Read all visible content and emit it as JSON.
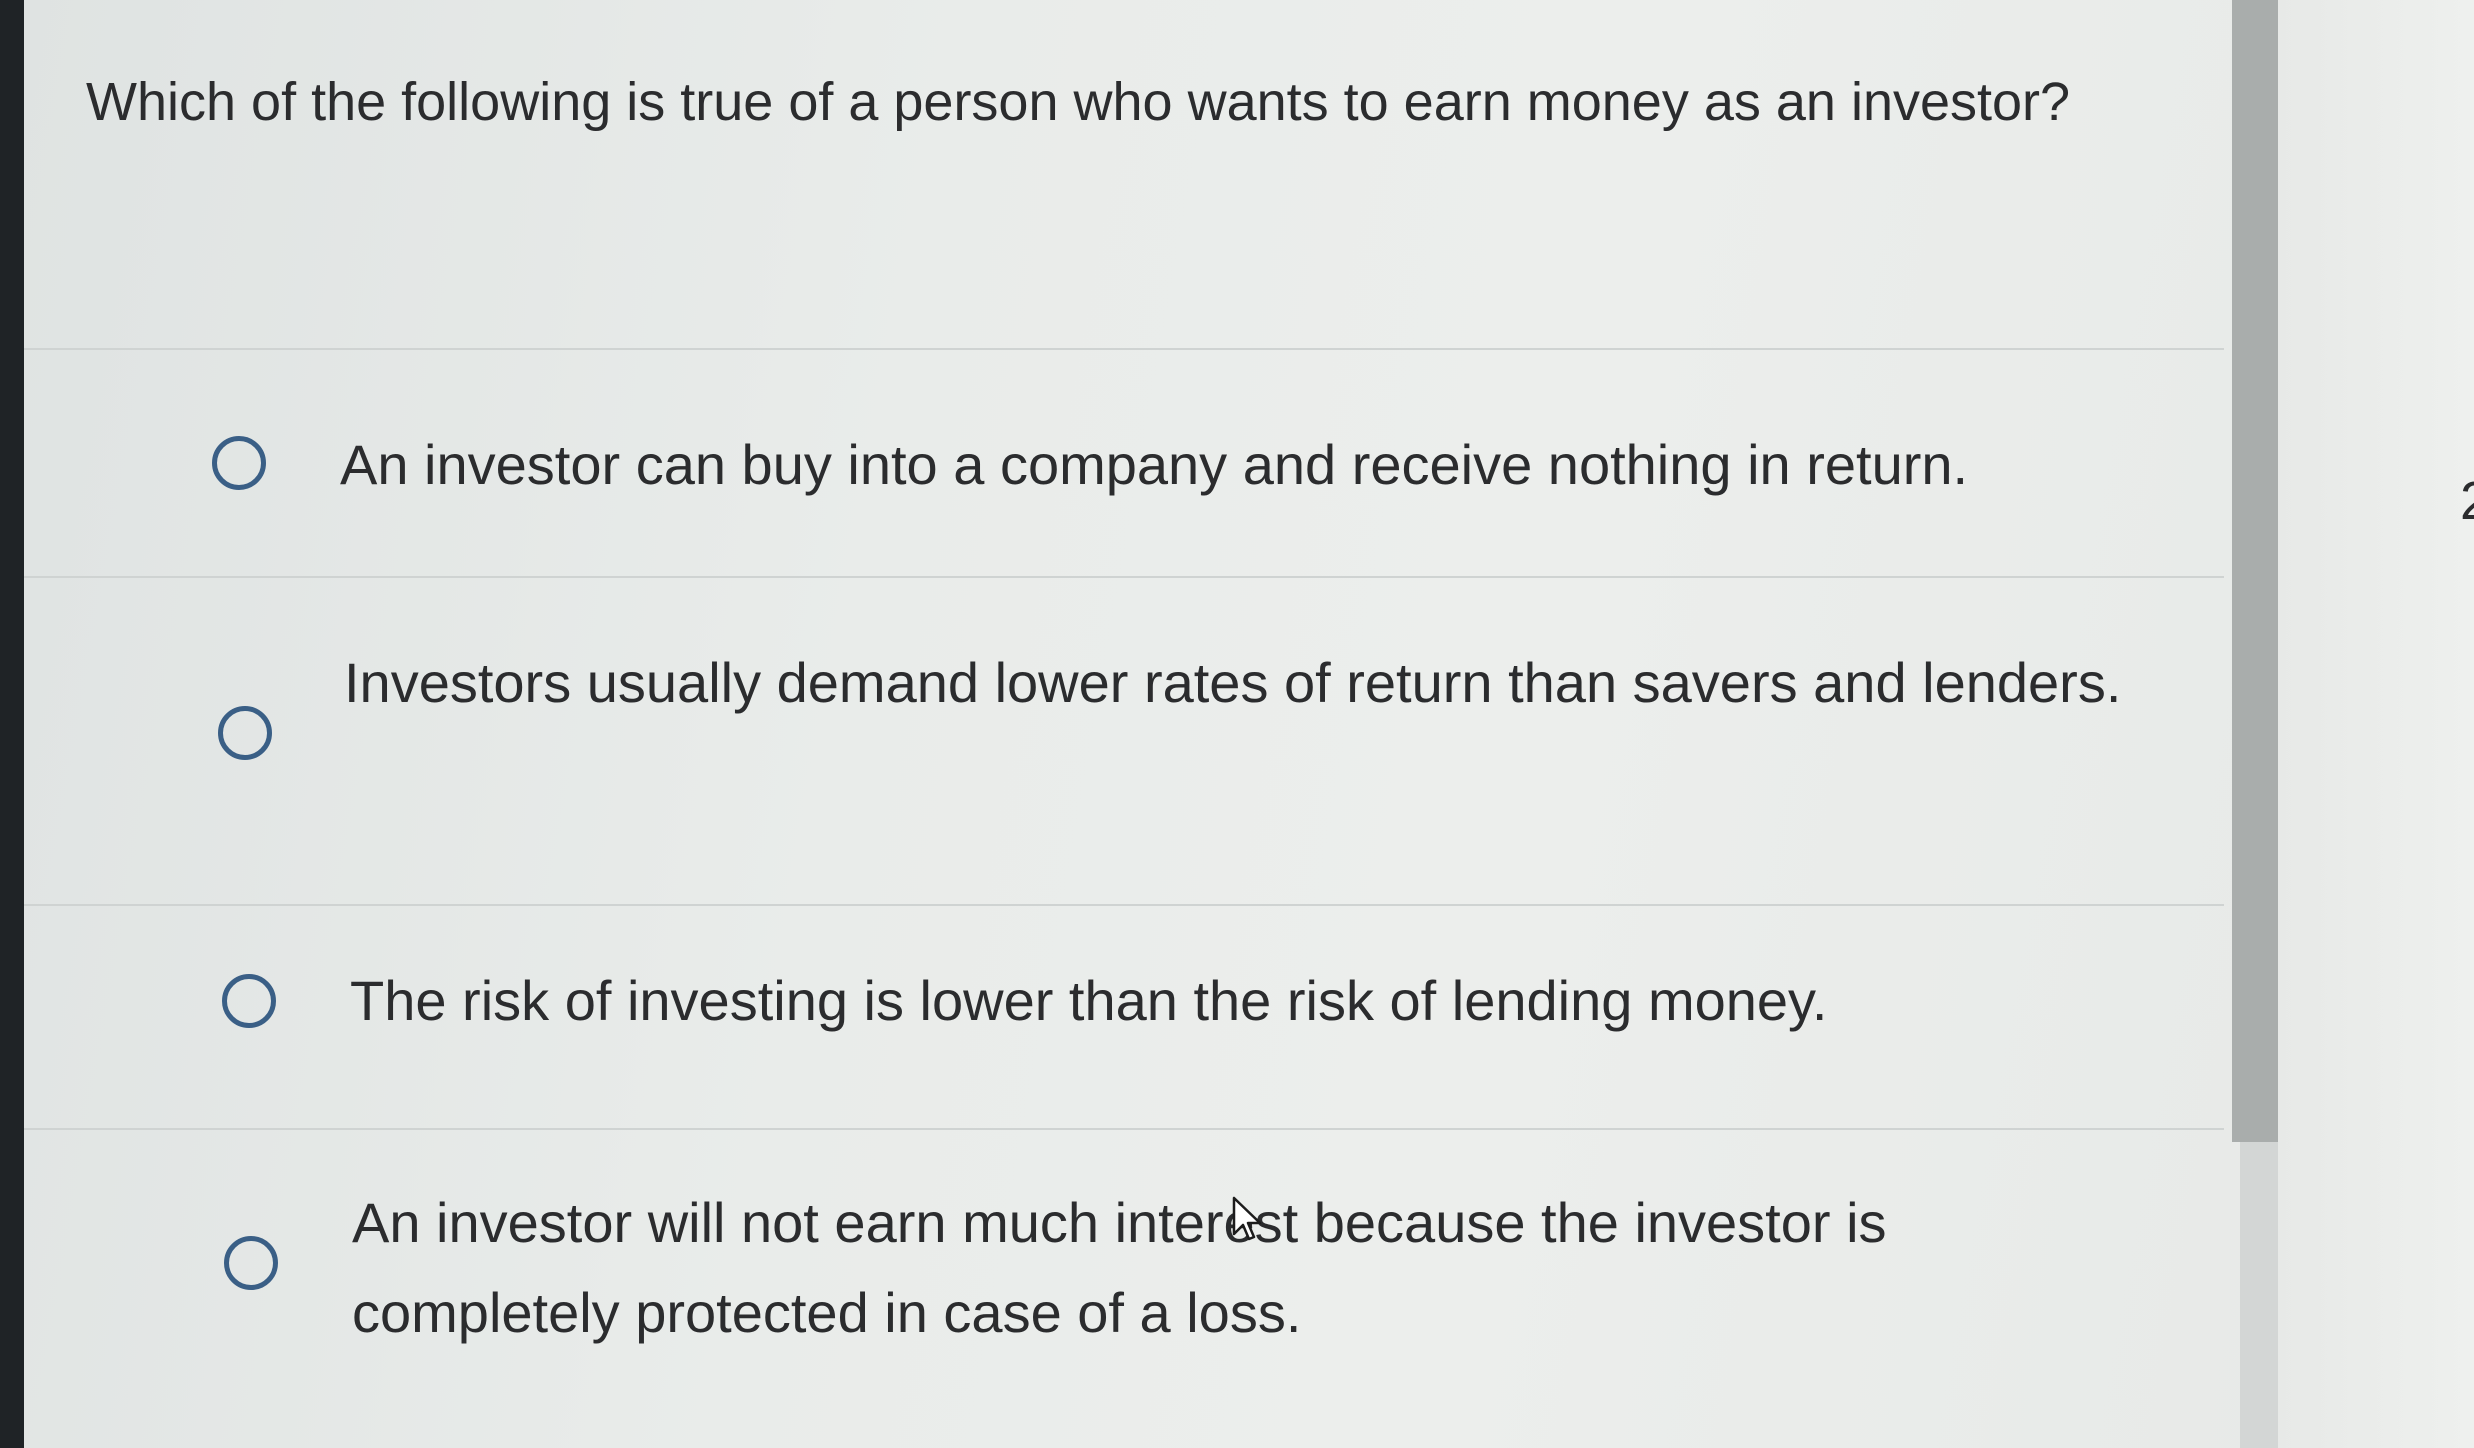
{
  "question": {
    "text": "Which of the following is true of a person who wants to earn money as an investor?"
  },
  "options": [
    {
      "label": "An investor can buy into a company and receive nothing in return.",
      "selected": false
    },
    {
      "label": "Investors usually demand lower rates of return than savers and lenders.",
      "selected": false
    },
    {
      "label": "The risk of investing is lower than the risk of lending money.",
      "selected": false
    },
    {
      "label": "An investor will not earn much interest because the investor is completely protected in case of a loss.",
      "selected": false
    }
  ],
  "colors": {
    "radio_border": "#3a5f86",
    "text": "#2b2c2e",
    "background": "#e9ecea"
  },
  "icons": {
    "radio": "radio-circle-icon",
    "cursor": "mouse-pointer-icon"
  }
}
